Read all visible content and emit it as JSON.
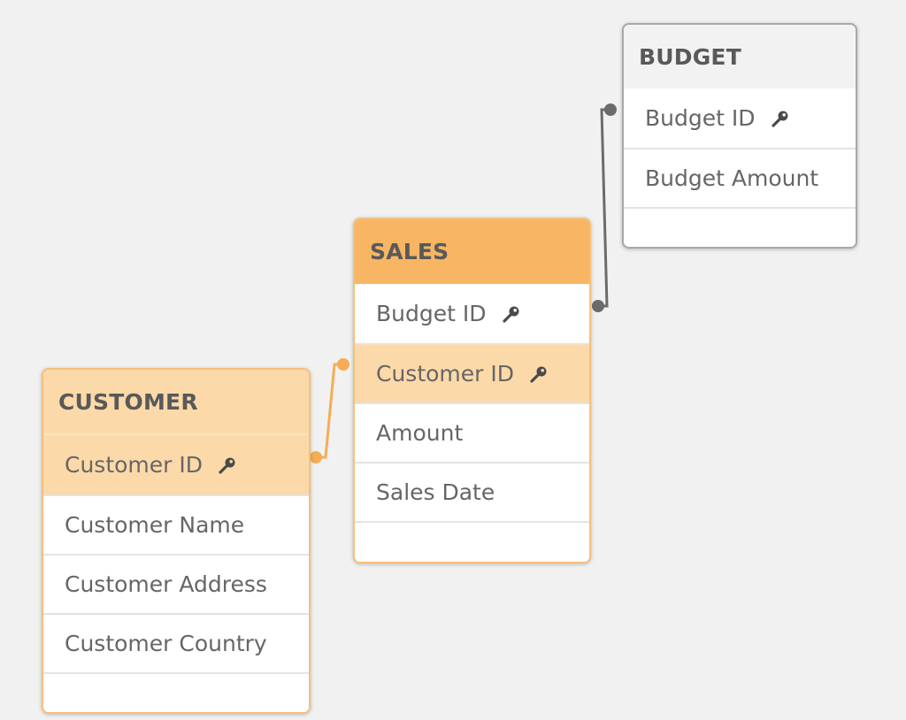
{
  "colors": {
    "background": "#f1f1f1",
    "sales_header": "#f8b563",
    "associated_highlight": "#fcd9a8",
    "neutral_header": "#f2f2f2",
    "orange_link": "#f4ad55",
    "gray_link": "#6b6b6b"
  },
  "tables": {
    "budget": {
      "name": "BUDGET",
      "fields": [
        {
          "label": "Budget ID",
          "icon": "key-icon",
          "is_key": true
        },
        {
          "label": "Budget Amount",
          "icon": "",
          "is_key": false
        }
      ]
    },
    "sales": {
      "name": "SALES",
      "fields": [
        {
          "label": "Budget ID",
          "icon": "key-icon",
          "is_key": true
        },
        {
          "label": "Customer ID",
          "icon": "key-icon",
          "is_key": true
        },
        {
          "label": "Amount",
          "icon": "",
          "is_key": false
        },
        {
          "label": "Sales Date",
          "icon": "",
          "is_key": false
        }
      ]
    },
    "customer": {
      "name": "CUSTOMER",
      "fields": [
        {
          "label": "Customer ID",
          "icon": "key-icon",
          "is_key": true
        },
        {
          "label": "Customer Name",
          "icon": "",
          "is_key": false
        },
        {
          "label": "Customer Address",
          "icon": "",
          "is_key": false
        },
        {
          "label": "Customer Country",
          "icon": "",
          "is_key": false
        }
      ]
    }
  },
  "links": [
    {
      "from": "CUSTOMER.Customer ID",
      "to": "SALES.Customer ID",
      "color": "orange"
    },
    {
      "from": "SALES.Budget ID",
      "to": "BUDGET.Budget ID",
      "color": "gray"
    }
  ]
}
